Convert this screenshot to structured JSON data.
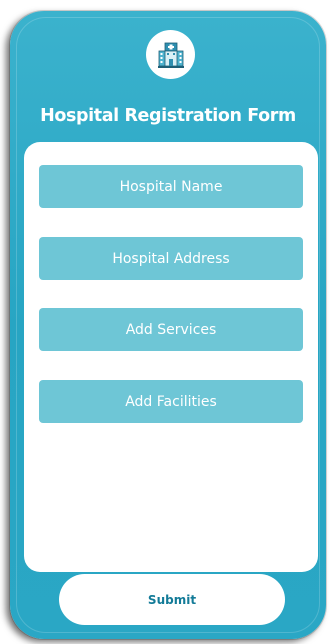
{
  "header": {
    "logo_icon": "hospital-icon",
    "title": "Hospital Registration Form"
  },
  "form": {
    "fields": [
      {
        "placeholder": "Hospital Name"
      },
      {
        "placeholder": "Hospital Address"
      },
      {
        "placeholder": "Add Services"
      },
      {
        "placeholder": "Add Facilities"
      }
    ],
    "submit_label": "Submit"
  },
  "colors": {
    "background": "#2aa7c5",
    "card": "#ffffff",
    "field": "#6ec6d6",
    "submit_text": "#137b98"
  }
}
